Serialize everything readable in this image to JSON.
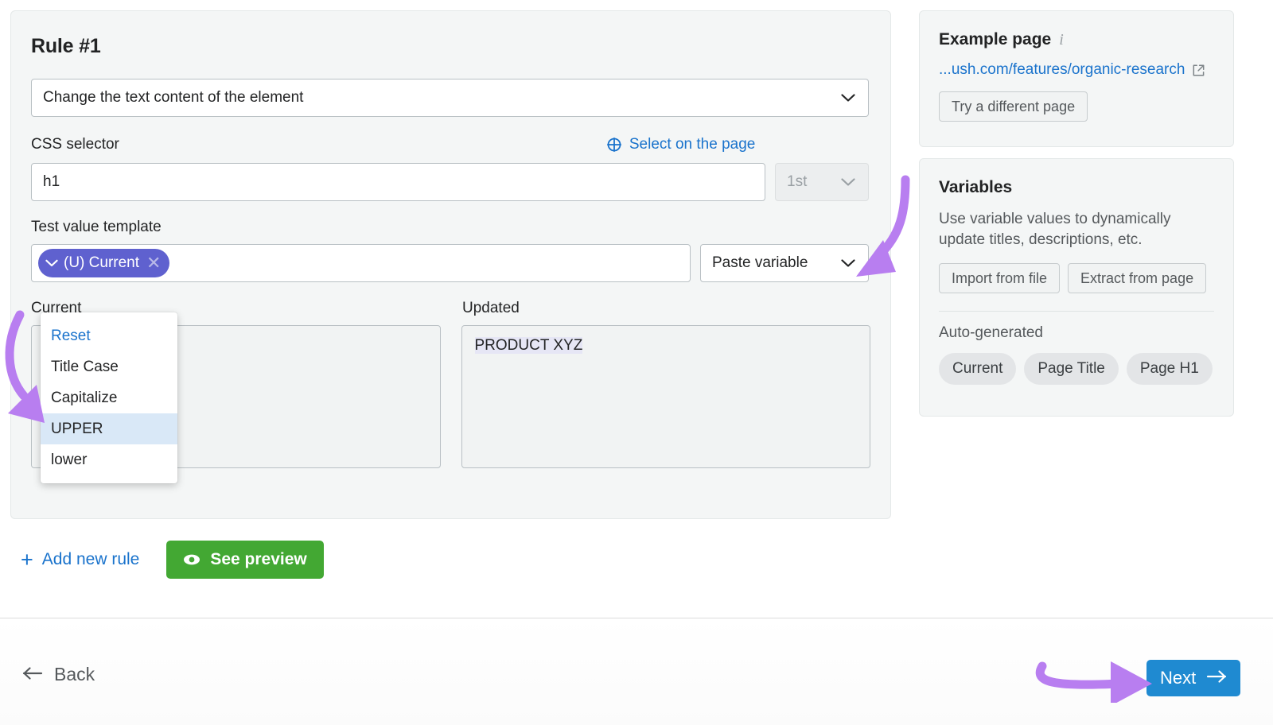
{
  "rule": {
    "title": "Rule #1",
    "action_select": {
      "value": "Change the text content of the element",
      "chevron_icon": "chevron-down-icon"
    },
    "css_selector": {
      "label": "CSS selector",
      "select_on_page": "Select on the page",
      "select_on_page_icon": "crosshair-target-icon",
      "value": "h1",
      "ordinal_value": "1st",
      "ordinal_chevron_icon": "chevron-down-icon"
    },
    "test_value_template": {
      "label": "Test value template",
      "chip_label": "(U) Current",
      "chip_chevron_icon": "chevron-down-icon",
      "chip_remove_icon": "close-icon",
      "paste_variable_label": "Paste variable",
      "paste_variable_chevron_icon": "chevron-down-icon"
    },
    "transform_dropdown": {
      "items": [
        {
          "label": "Reset",
          "style": "reset",
          "active": false
        },
        {
          "label": "Title Case",
          "style": "normal",
          "active": false
        },
        {
          "label": "Capitalize",
          "style": "normal",
          "active": false
        },
        {
          "label": "UPPER",
          "style": "normal",
          "active": true
        },
        {
          "label": "lower",
          "style": "normal",
          "active": false
        }
      ]
    },
    "preview": {
      "current_label": "Current",
      "updated_label": "Updated",
      "current_value": "",
      "updated_value": "PRODUCT XYZ"
    }
  },
  "actions": {
    "add_new_rule": "Add new rule",
    "add_icon": "plus-icon",
    "see_preview": "See preview",
    "see_preview_icon": "eye-icon"
  },
  "footer": {
    "back_label": "Back",
    "back_icon": "arrow-left-icon",
    "next_label": "Next",
    "next_icon": "arrow-right-icon"
  },
  "example_page": {
    "title": "Example page",
    "info_icon": "info-icon",
    "url": "...ush.com/features/organic-research",
    "external_link_icon": "external-link-icon",
    "try_different_page": "Try a different page"
  },
  "variables": {
    "title": "Variables",
    "description": "Use variable values to dynamically update titles, descriptions, etc.",
    "import_from_file": "Import from file",
    "extract_from_page": "Extract from page",
    "auto_generated_label": "Auto-generated",
    "pills": [
      "Current",
      "Page Title",
      "Page H1"
    ]
  },
  "colors": {
    "accent_blue": "#1a73cc",
    "chip_purple": "#5f61cf",
    "green": "#43a833",
    "next_blue": "#1f8ad1",
    "annotation_purple": "#b87ef0",
    "highlight_lavender": "#e6e6f5",
    "menu_active_blue": "#d9e8f7"
  }
}
